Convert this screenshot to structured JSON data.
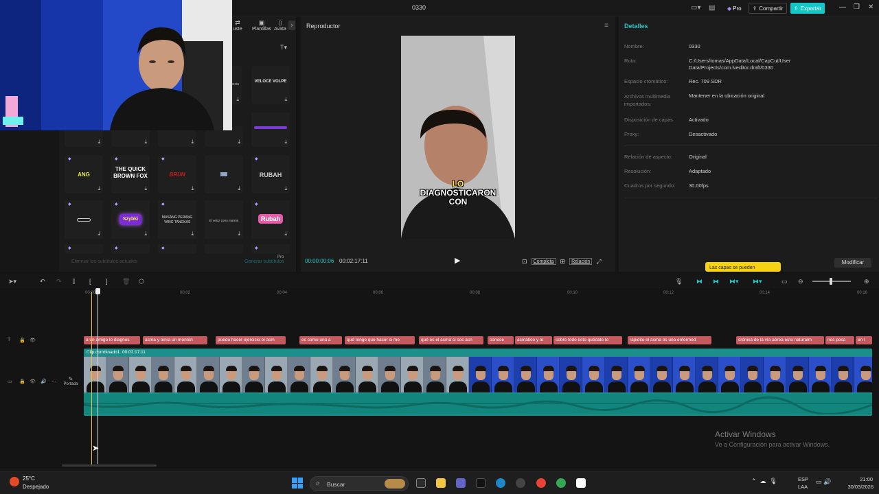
{
  "window": {
    "title": "0330",
    "pro_label": "Pro",
    "share_label": "Compartir",
    "export_label": "Exportar"
  },
  "panel": {
    "tabs": [
      {
        "label": "uste",
        "icon": "adjust-icon"
      },
      {
        "label": "Plantillas",
        "icon": "templates-icon"
      },
      {
        "label": "Avata",
        "icon": "avatar-icon"
      }
    ],
    "tiles": [
      {
        "text": "VELOCE VOLPE",
        "color": "#e8e8e8"
      },
      {
        "text": "ANG",
        "color": "#e9e84a"
      },
      {
        "text": "THE QUICK BROWN FOX",
        "color": "#ffffff"
      },
      {
        "text": "BRUN",
        "color": "#d01c1c"
      },
      {
        "text": "RUBAH",
        "color": "#c9c9c9"
      },
      {
        "text": "Szybki",
        "color": "#ffe94a"
      },
      {
        "text": "MUSANG PERANG YANG TANGKAS",
        "color": "#e0e0e0"
      },
      {
        "text": "El veloz zorro marrón",
        "color": "#cccccc"
      },
      {
        "text": "Rubah",
        "color": "#ffffff"
      }
    ],
    "footer_left": "Eliminar los subtítulos actuales",
    "footer_right": "Generar subtítulos",
    "footer_pro": "Pro"
  },
  "player": {
    "title": "Reproductor",
    "caption_highlight": "LO",
    "caption_rest": "DIAGNOSTICARON CON",
    "time_current": "00:00:00:06",
    "time_total": "00:02:17:11",
    "btn_full": "Completa",
    "btn_ratio": "Relación"
  },
  "details": {
    "title": "Detalles",
    "rows": [
      {
        "label": "Nombre:",
        "value": "0330"
      },
      {
        "label": "Ruta:",
        "value": "C:/Users/tomas/AppData/Local/CapCut/User Data/Projects/com.lveditor.draft/0330"
      },
      {
        "label": "Espacio cromático:",
        "value": "Rec. 709 SDR"
      },
      {
        "label": "Archivos multimedia importados:",
        "value": "Mantener en la ubicación original"
      },
      {
        "label": "Disposición de capas",
        "value": "Activado"
      },
      {
        "label": "Proxy:",
        "value": "Desactivado"
      },
      {
        "label": "Relación de aspecto:",
        "value": "Original"
      },
      {
        "label": "Resolución:",
        "value": "Adaptado"
      },
      {
        "label": "Cuadros por segundo:",
        "value": "30.00fps"
      }
    ],
    "modify_label": "Modificar",
    "tooltip": "Las capas se pueden"
  },
  "timeline": {
    "ruler": [
      "00:00",
      "00:02",
      "00:04",
      "00:06",
      "00:08",
      "00:10",
      "00:12",
      "00:14",
      "00:16"
    ],
    "subtitles": [
      "a un amigo lo diagnos",
      "asma y tenía un montón",
      "puedo hacer ejercicio el asm",
      "es como una a",
      "qué tengo que hacer si me",
      "qué es el asma si sos asn",
      "conoce",
      "asmático y te",
      "sobre todo esto quédate te",
      "rapidito el asma es una enfermed",
      "crónica de la vía aérea esto naturalm",
      "nos posa",
      "en l"
    ],
    "clip_label": "Clip combinado1",
    "clip_duration": "00:02:17:11",
    "cover_label": "Portada"
  },
  "watermark": {
    "title": "Activar Windows",
    "subtitle": "Ve a Configuración para activar Windows."
  },
  "taskbar": {
    "temp": "25°C",
    "condition": "Despejado",
    "search_placeholder": "Buscar",
    "lang1": "ESP",
    "lang2": "LAA",
    "time": "21:00",
    "date": "30/03/2026"
  }
}
